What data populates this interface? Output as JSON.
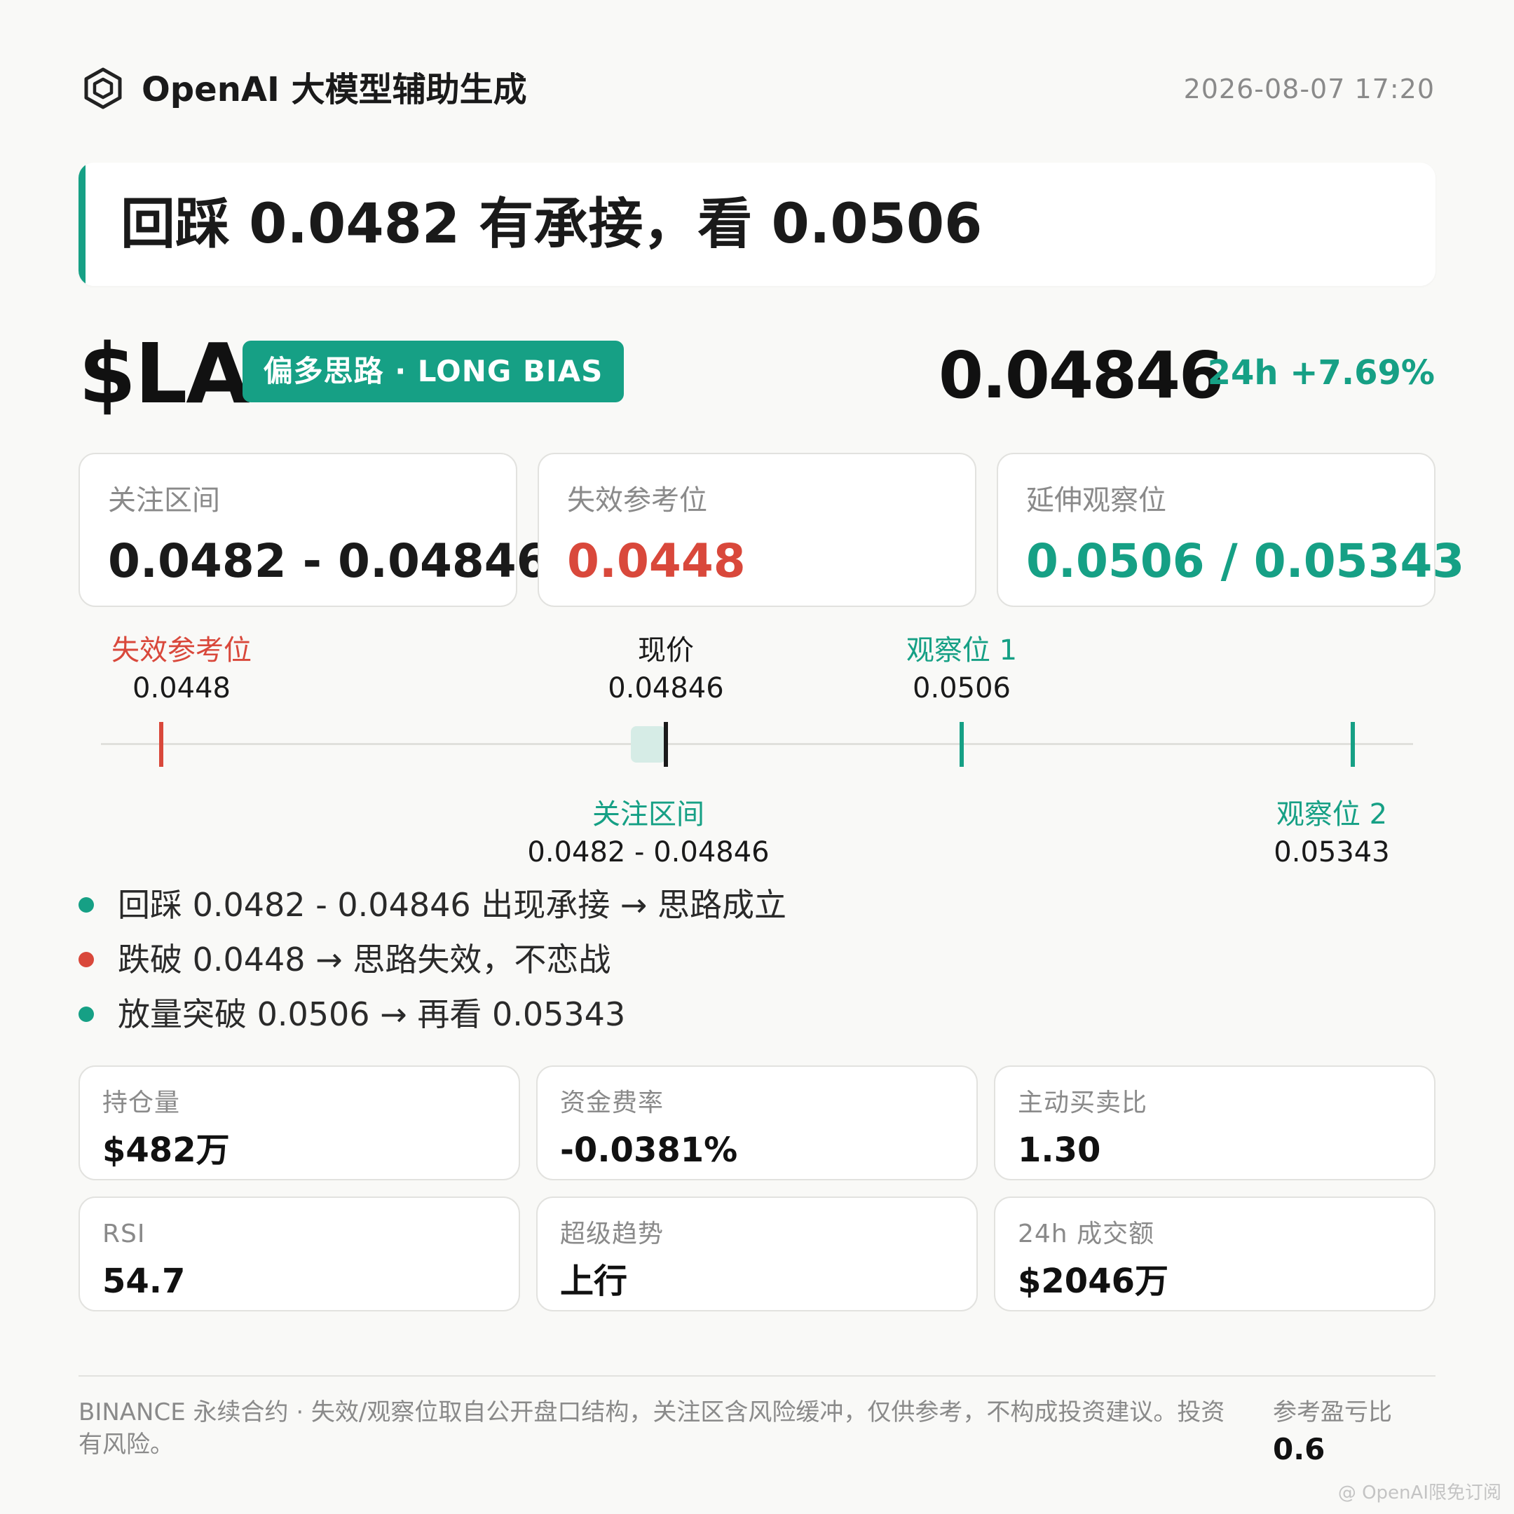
{
  "header": {
    "brand_icon": "hexagon-logo-icon",
    "brand_name": "OpenAI 大模型辅助生成",
    "timestamp": "2026-08-07 17:20"
  },
  "headline": "回踩 0.0482 有承接，看 0.0506",
  "symbol": {
    "ticker": "$LA",
    "bias": "偏多思路 · LONG BIAS",
    "price": "0.04846",
    "change": "24h +7.69%"
  },
  "levels": [
    {
      "label": "关注区间",
      "value": "0.0482 - 0.04846",
      "color": "#1a1a1a"
    },
    {
      "label": "失效参考位",
      "value": "0.0448",
      "color": "#d9483b"
    },
    {
      "label": "延伸观察位",
      "value": "0.0506 / 0.05343",
      "color": "#16a085"
    }
  ],
  "ladder": {
    "invalid": {
      "label": "失效参考位",
      "value": "0.0448"
    },
    "current": {
      "label": "现价",
      "value": "0.04846"
    },
    "target1": {
      "label": "观察位 1",
      "value": "0.0506"
    },
    "zone": {
      "label": "关注区间",
      "value": "0.0482 - 0.04846"
    },
    "target2": {
      "label": "观察位 2",
      "value": "0.05343"
    }
  },
  "bullets": [
    {
      "text": "回踩 0.0482 - 0.04846 出现承接 → 思路成立",
      "color": "#16a085"
    },
    {
      "text": "跌破 0.0448 → 思路失效，不恋战",
      "color": "#d9483b"
    },
    {
      "text": "放量突破 0.0506 → 再看 0.05343",
      "color": "#16a085"
    }
  ],
  "stats": [
    {
      "label": "持仓量",
      "value": "$482万"
    },
    {
      "label": "资金费率",
      "value": "-0.0381%"
    },
    {
      "label": "主动买卖比",
      "value": "1.30"
    },
    {
      "label": "RSI",
      "value": "54.7"
    },
    {
      "label": "超级趋势",
      "value": "上行"
    },
    {
      "label": "24h 成交额",
      "value": "$2046万"
    }
  ],
  "footer": {
    "disclaimer": "BINANCE 永续合约 · 失效/观察位取自公开盘口结构，关注区含风险缓冲，仅供参考，不构成投资建议。投资有风险。",
    "rr_label": "参考盈亏比",
    "rr_value": "0.6"
  },
  "watermark": "@ OpenAI限免订阅",
  "colors": {
    "accent": "#16a085",
    "danger": "#d9483b"
  }
}
